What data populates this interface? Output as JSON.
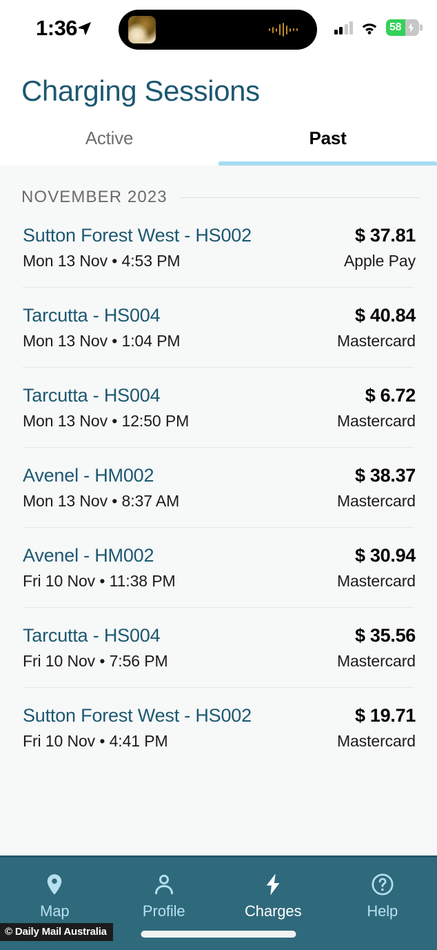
{
  "status_bar": {
    "time": "1:36",
    "location_icon": "location-arrow-icon",
    "dynamic_island": {
      "album_art": "album-art-thumbnail",
      "audio_waveform": "audio-waveform-icon"
    },
    "cellular_icon": "cellular-signal-icon",
    "cellular_bars_filled": 2,
    "cellular_bars_total": 4,
    "wifi_icon": "wifi-icon",
    "battery_percent": "58",
    "battery_level": 58,
    "battery_charging": true,
    "battery_color": "#33d158"
  },
  "header": {
    "title": "Charging Sessions",
    "title_color": "#1d5871",
    "tabs": [
      {
        "label": "Active",
        "active": false
      },
      {
        "label": "Past",
        "active": true
      }
    ],
    "active_tab_indicator_color": "#a6dcf2"
  },
  "list": {
    "month_header": "NOVEMBER 2023",
    "sessions": [
      {
        "name": "Sutton Forest West - HS002",
        "when": "Mon 13 Nov • 4:53 PM",
        "amount": "$ 37.81",
        "method": "Apple Pay"
      },
      {
        "name": "Tarcutta - HS004",
        "when": "Mon 13 Nov • 1:04 PM",
        "amount": "$ 40.84",
        "method": "Mastercard"
      },
      {
        "name": "Tarcutta - HS004",
        "when": "Mon 13 Nov • 12:50 PM",
        "amount": "$ 6.72",
        "method": "Mastercard"
      },
      {
        "name": "Avenel - HM002",
        "when": "Mon 13 Nov • 8:37 AM",
        "amount": "$ 38.37",
        "method": "Mastercard"
      },
      {
        "name": "Avenel - HM002",
        "when": "Fri 10 Nov • 11:38 PM",
        "amount": "$ 30.94",
        "method": "Mastercard"
      },
      {
        "name": "Tarcutta - HS004",
        "when": "Fri 10 Nov • 7:56 PM",
        "amount": "$ 35.56",
        "method": "Mastercard"
      },
      {
        "name": "Sutton Forest West - HS002",
        "when": "Fri 10 Nov • 4:41 PM",
        "amount": "$ 19.71",
        "method": "Mastercard"
      }
    ]
  },
  "bottom_nav": {
    "background_color": "#2f6a7c",
    "inactive_color": "#b6e0ef",
    "active_color": "#ffffff",
    "items": [
      {
        "label": "Map",
        "icon": "map-pin-icon",
        "active": false
      },
      {
        "label": "Profile",
        "icon": "person-icon",
        "active": false
      },
      {
        "label": "Charges",
        "icon": "lightning-bolt-icon",
        "active": true
      },
      {
        "label": "Help",
        "icon": "question-circle-icon",
        "active": false
      }
    ]
  },
  "watermark": {
    "text": "© Daily Mail Australia"
  }
}
